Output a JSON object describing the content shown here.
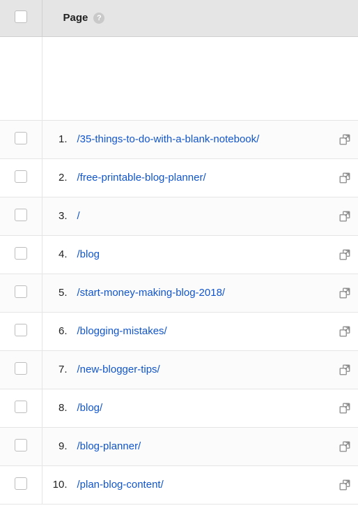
{
  "header": {
    "column_label": "Page",
    "help_symbol": "?"
  },
  "rows": [
    {
      "rank": "1.",
      "path": "/35-things-to-do-with-a-blank-notebook/"
    },
    {
      "rank": "2.",
      "path": "/free-printable-blog-planner/"
    },
    {
      "rank": "3.",
      "path": "/"
    },
    {
      "rank": "4.",
      "path": "/blog"
    },
    {
      "rank": "5.",
      "path": "/start-money-making-blog-2018/"
    },
    {
      "rank": "6.",
      "path": "/blogging-mistakes/"
    },
    {
      "rank": "7.",
      "path": "/new-blogger-tips/"
    },
    {
      "rank": "8.",
      "path": "/blog/"
    },
    {
      "rank": "9.",
      "path": "/blog-planner/"
    },
    {
      "rank": "10.",
      "path": "/plan-blog-content/"
    }
  ]
}
